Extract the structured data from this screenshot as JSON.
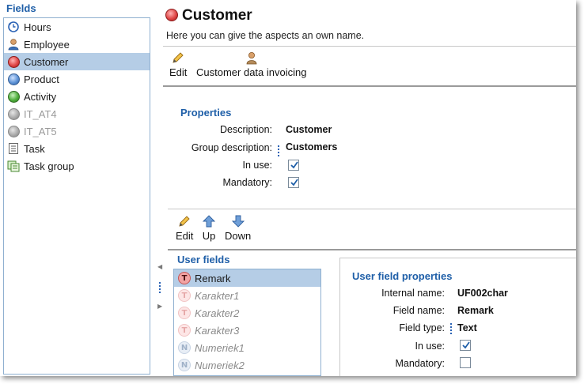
{
  "left": {
    "title": "Fields",
    "items": [
      {
        "label": "Hours",
        "icon": "clock-refresh-icon"
      },
      {
        "label": "Employee",
        "icon": "person-icon"
      },
      {
        "label": "Customer",
        "icon": "red-ball-icon"
      },
      {
        "label": "Product",
        "icon": "blue-ball-icon"
      },
      {
        "label": "Activity",
        "icon": "green-ball-icon"
      },
      {
        "label": "IT_AT4",
        "icon": "gray-ball-icon"
      },
      {
        "label": "IT_AT5",
        "icon": "gray-ball-icon"
      },
      {
        "label": "Task",
        "icon": "list-icon"
      },
      {
        "label": "Task group",
        "icon": "task-group-icon"
      }
    ],
    "selected": "Customer"
  },
  "header": {
    "title": "Customer",
    "subtitle": "Here you can give the aspects an own name."
  },
  "toolbar1": {
    "edit_label": "Edit",
    "customer_data_label": "Customer data invoicing"
  },
  "properties": {
    "title": "Properties",
    "description_label": "Description:",
    "description_value": "Customer",
    "group_label": "Group description:",
    "group_value": "Customers",
    "in_use_label": "In use:",
    "in_use": true,
    "mandatory_label": "Mandatory:",
    "mandatory": true
  },
  "toolbar2": {
    "edit_label": "Edit",
    "up_label": "Up",
    "down_label": "Down"
  },
  "user_fields": {
    "title": "User fields",
    "items": [
      {
        "badge": "T",
        "label": "Remark",
        "active": true
      },
      {
        "badge": "T",
        "label": "Karakter1",
        "active": false
      },
      {
        "badge": "T",
        "label": "Karakter2",
        "active": false
      },
      {
        "badge": "T",
        "label": "Karakter3",
        "active": false
      },
      {
        "badge": "N",
        "label": "Numeriek1",
        "active": false
      },
      {
        "badge": "N",
        "label": "Numeriek2",
        "active": false
      }
    ]
  },
  "user_field_properties": {
    "title": "User field properties",
    "internal_name_label": "Internal name:",
    "internal_name_value": "UF002char",
    "field_name_label": "Field name:",
    "field_name_value": "Remark",
    "field_type_label": "Field type:",
    "field_type_value": "Text",
    "in_use_label": "In use:",
    "in_use": true,
    "mandatory_label": "Mandatory:",
    "mandatory": false
  },
  "colors": {
    "accent": "#1f5fa8",
    "selection": "#b5cde6"
  }
}
